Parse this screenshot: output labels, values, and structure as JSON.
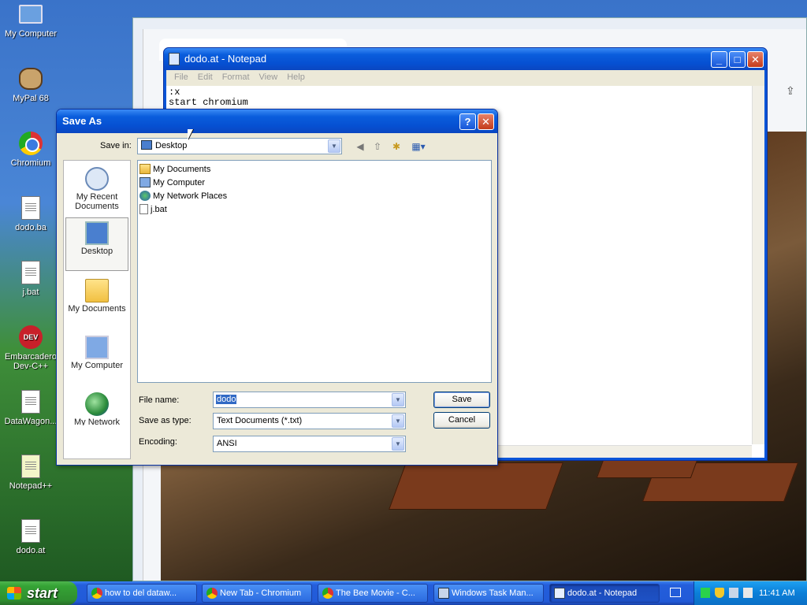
{
  "desktop": {
    "icons": [
      {
        "label": "My Computer",
        "icon": "my-computer-icon"
      },
      {
        "label": "MyPal 68",
        "icon": "mypal-icon"
      },
      {
        "label": "Chromium",
        "icon": "chromium-icon"
      },
      {
        "label": "dodo.ba",
        "icon": "batch-file-icon"
      },
      {
        "label": "j.bat",
        "icon": "batch-file-icon"
      },
      {
        "label": "Embarcadero Dev-C++",
        "icon": "devcpp-icon",
        "badge": "DEV"
      },
      {
        "label": "DataWagon...",
        "icon": "batch-file-icon"
      },
      {
        "label": "Notepad++",
        "icon": "notepadpp-icon"
      },
      {
        "label": "dodo.at",
        "icon": "batch-file-icon"
      }
    ]
  },
  "notepad": {
    "title": "dodo.at - Notepad",
    "menu": [
      "File",
      "Edit",
      "Format",
      "View",
      "Help"
    ],
    "content_lines": [
      ":x",
      "start chromium"
    ]
  },
  "saveas": {
    "title": "Save As",
    "save_in_label": "Save in:",
    "save_in_value": "Desktop",
    "places": [
      {
        "label": "My Recent Documents",
        "icon": "recent-documents-icon",
        "selected": false
      },
      {
        "label": "Desktop",
        "icon": "desktop-icon",
        "selected": true
      },
      {
        "label": "My Documents",
        "icon": "folder-icon",
        "selected": false
      },
      {
        "label": "My Computer",
        "icon": "computer-icon",
        "selected": false
      },
      {
        "label": "My Network",
        "icon": "network-icon",
        "selected": false
      }
    ],
    "files": [
      {
        "name": "My Documents",
        "icon": "folder-icon"
      },
      {
        "name": "My Computer",
        "icon": "computer-icon"
      },
      {
        "name": "My Network Places",
        "icon": "network-icon"
      },
      {
        "name": "j.bat",
        "icon": "batch-file-icon"
      }
    ],
    "file_name_label": "File name:",
    "file_name_value": "dodo",
    "save_as_type_label": "Save as type:",
    "save_as_type_value": "Text Documents (*.txt)",
    "encoding_label": "Encoding:",
    "encoding_value": "ANSI",
    "save_label": "Save",
    "cancel_label": "Cancel",
    "help_glyph": "?",
    "close_glyph": "✕"
  },
  "taskbar": {
    "start_label": "start",
    "tasks": [
      {
        "label": "how to del dataw...",
        "icon": "chromium-icon",
        "active": false
      },
      {
        "label": "New Tab - Chromium",
        "icon": "chromium-icon",
        "active": false
      },
      {
        "label": "The Bee Movie - C...",
        "icon": "chromium-icon",
        "active": false
      },
      {
        "label": "Windows Task Man...",
        "icon": "task-manager-icon",
        "active": false
      },
      {
        "label": "dodo.at - Notepad",
        "icon": "notepad-icon",
        "active": true
      }
    ],
    "clock": "11:41 AM"
  },
  "colors": {
    "xp_blue_title": "#0a5ddc",
    "dialog_face": "#ece9d8",
    "taskbar_blue": "#245edb",
    "start_green": "#35a335"
  }
}
